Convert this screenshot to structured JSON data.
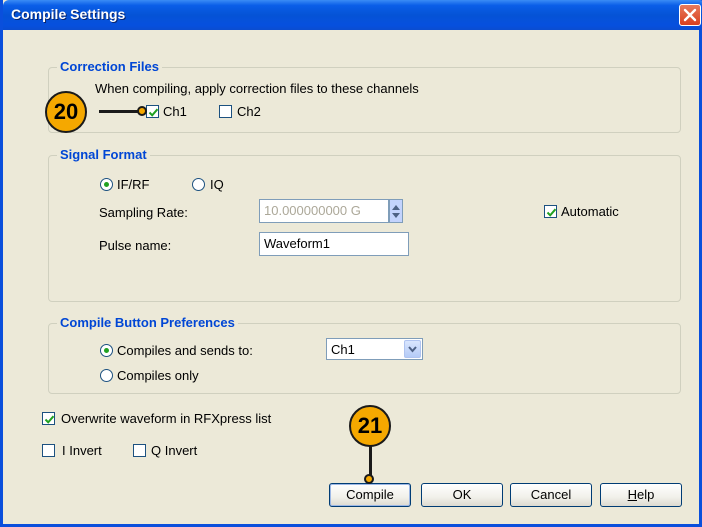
{
  "window": {
    "title": "Compile Settings"
  },
  "correction_files": {
    "legend": "Correction Files",
    "description": "When compiling, apply correction files to these channels",
    "ch1": {
      "label": "Ch1",
      "checked": true
    },
    "ch2": {
      "label": "Ch2",
      "checked": false
    }
  },
  "signal_format": {
    "legend": "Signal Format",
    "if_rf": {
      "label": "IF/RF",
      "selected": true
    },
    "iq": {
      "label": "IQ",
      "selected": false
    },
    "sampling_rate_label": "Sampling Rate:",
    "sampling_rate_value": "10.000000000 G",
    "automatic": {
      "label": "Automatic",
      "checked": true
    },
    "pulse_name_label": "Pulse name:",
    "pulse_name_value": "Waveform1"
  },
  "compile_prefs": {
    "legend": "Compile Button Preferences",
    "compiles_and_sends": {
      "label": "Compiles and sends to:",
      "selected": true
    },
    "channel_value": "Ch1",
    "compiles_only": {
      "label": "Compiles only",
      "selected": false
    }
  },
  "overwrite": {
    "label": "Overwrite waveform in RFXpress list",
    "checked": true
  },
  "i_invert": {
    "label": "I Invert",
    "checked": false
  },
  "q_invert": {
    "label": "Q Invert",
    "checked": false
  },
  "buttons": {
    "compile": "Compile",
    "ok": "OK",
    "cancel": "Cancel",
    "help_rest": "elp",
    "help_key": "H"
  },
  "callouts": {
    "c20": "20",
    "c21": "21"
  },
  "colors": {
    "title_bar": "#0553d6",
    "legend_text": "#0046d5",
    "callout_fill": "#f5a800",
    "check_mark": "#21a121"
  }
}
